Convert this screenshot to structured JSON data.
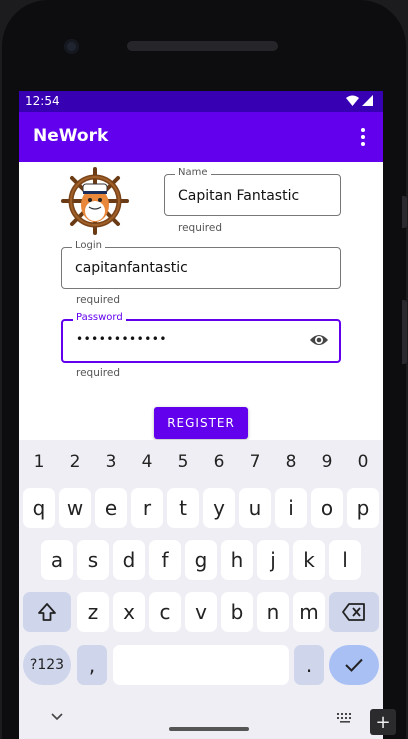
{
  "status_bar": {
    "time": "12:54",
    "wifi_icon": "wifi-icon",
    "signal_icon": "signal-icon"
  },
  "app_bar": {
    "title": "NeWork",
    "menu_icon": "overflow-menu-icon"
  },
  "avatar": {
    "description": "avatar-icon"
  },
  "form": {
    "name": {
      "label": "Name",
      "value": "Capitan Fantastic",
      "helper": "required"
    },
    "login": {
      "label": "Login",
      "value": "capitanfantastic",
      "helper": "required"
    },
    "password": {
      "label": "Password",
      "value": "••••••••••••",
      "helper": "required",
      "toggle_icon": "eye-icon"
    },
    "register_label": "REGISTER"
  },
  "keyboard": {
    "numbers": [
      "1",
      "2",
      "3",
      "4",
      "5",
      "6",
      "7",
      "8",
      "9",
      "0"
    ],
    "row1": [
      "q",
      "w",
      "e",
      "r",
      "t",
      "y",
      "u",
      "i",
      "o",
      "p"
    ],
    "row2": [
      "a",
      "s",
      "d",
      "f",
      "g",
      "h",
      "j",
      "k",
      "l"
    ],
    "row3": [
      "z",
      "x",
      "c",
      "v",
      "b",
      "n",
      "m"
    ],
    "symbols_label": "?123",
    "comma": ",",
    "period": "."
  },
  "colors": {
    "primary": "#6200ee",
    "primary_dark": "#3700b3"
  }
}
